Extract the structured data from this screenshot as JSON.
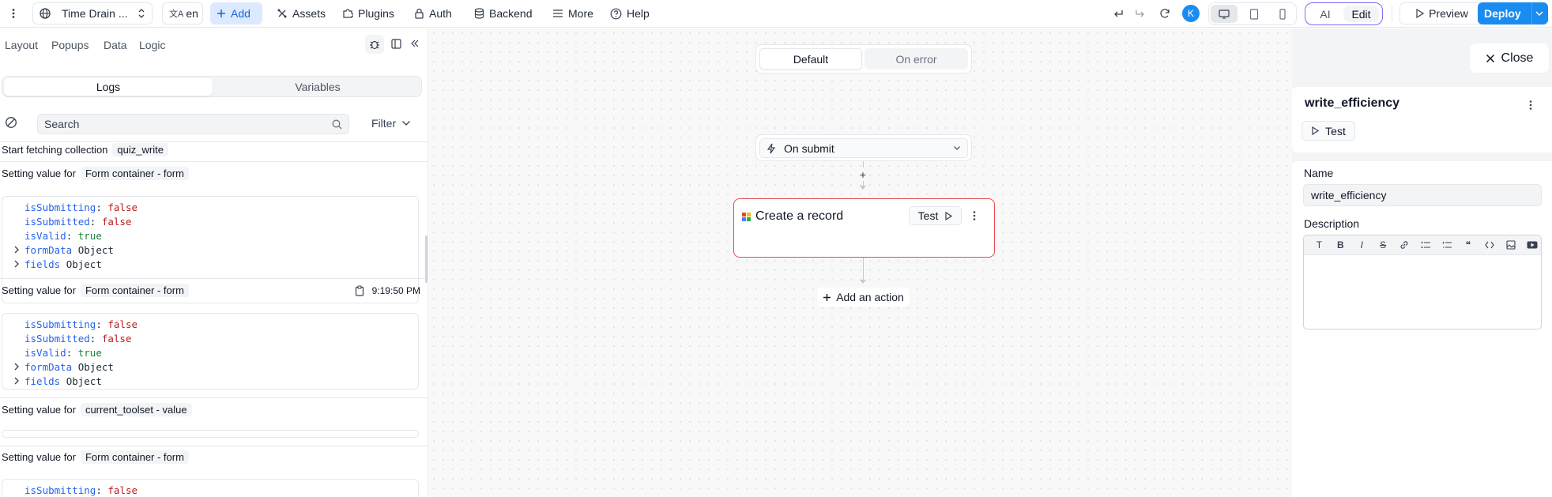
{
  "topbar": {
    "app_name": "Time Drain ...",
    "lang": "en",
    "add_label": "Add",
    "assets_label": "Assets",
    "plugins_label": "Plugins",
    "auth_label": "Auth",
    "backend_label": "Backend",
    "more_label": "More",
    "help_label": "Help",
    "avatar_letter": "K",
    "ai_label": "AI",
    "edit_label": "Edit",
    "preview_label": "Preview",
    "deploy_label": "Deploy"
  },
  "left": {
    "tabs": [
      "Layout",
      "Popups",
      "Data",
      "Logic"
    ],
    "segment": {
      "logs": "Logs",
      "variables": "Variables"
    },
    "search_placeholder": "Search",
    "filter_label": "Filter",
    "entries": [
      {
        "text": "Start fetching collection",
        "chip": "quiz_write"
      },
      {
        "text": "Setting value for",
        "chip": "Form container - form"
      },
      {
        "text": "Setting value for",
        "chip": "Form container - form",
        "time": "9:19:50 PM"
      },
      {
        "text": "Setting value for",
        "chip": "current_toolset - value"
      },
      {
        "text": "Setting value for",
        "chip": "Form container - form"
      }
    ],
    "code": {
      "isSubmitting": "isSubmitting",
      "isSubmitted": "isSubmitted",
      "isValid": "isValid",
      "false": "false",
      "true": "true",
      "formData": "formData",
      "fields": "fields",
      "object": "Object"
    }
  },
  "canvas": {
    "tabs": {
      "default": "Default",
      "on_error": "On error"
    },
    "trigger_label": "On submit",
    "action_title": "Create a record",
    "test_label": "Test",
    "add_action_label": "Add an action"
  },
  "right": {
    "close_label": "Close",
    "workflow_name": "write_efficiency",
    "test_label": "Test",
    "name_label": "Name",
    "name_value": "write_efficiency",
    "description_label": "Description"
  },
  "colors": {
    "accent": "#1a8cf0",
    "error_border": "#e5484d",
    "ai_edit_border": "#7c6cf0"
  }
}
